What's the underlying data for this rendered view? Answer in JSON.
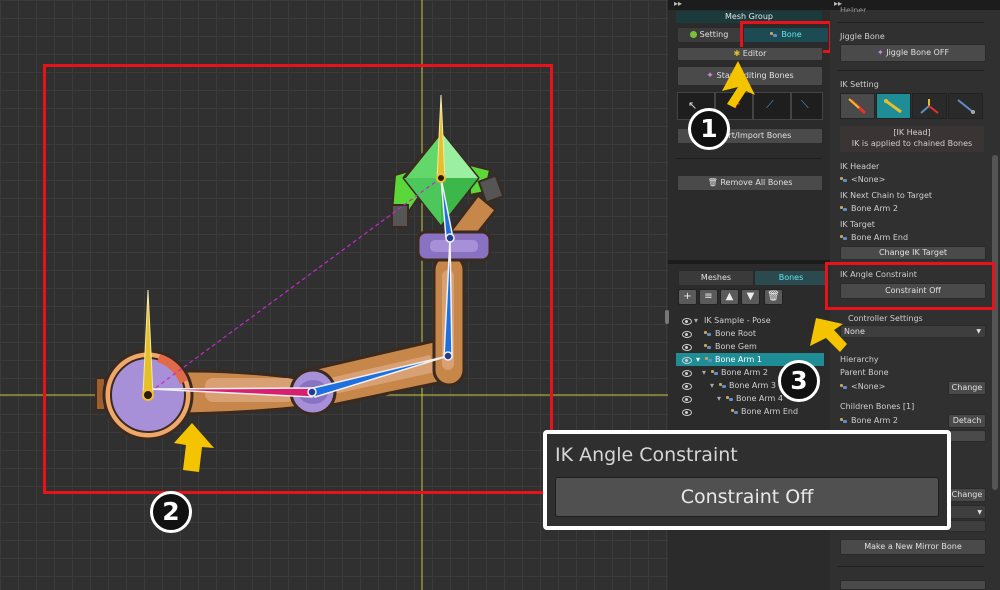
{
  "mesh_group": {
    "title": "Mesh Group",
    "setting_label": "Setting",
    "bone_label": "Bone",
    "editor_label": "Editor",
    "start_editing_label": "Start Editing Bones",
    "export_import_label": "Export/Import Bones",
    "remove_all_label": "Remove All Bones"
  },
  "list_tabs": {
    "meshes": "Meshes",
    "bones": "Bones"
  },
  "tree": [
    {
      "label": "IK Sample - Pose"
    },
    {
      "label": "Bone Root"
    },
    {
      "label": "Bone Gem"
    },
    {
      "label": "Bone Arm 1"
    },
    {
      "label": "Bone Arm 2"
    },
    {
      "label": "Bone Arm 3"
    },
    {
      "label": "Bone Arm 4"
    },
    {
      "label": "Bone Arm End"
    }
  ],
  "inspector": {
    "header_cut": "Helper",
    "jiggle_title": "Jiggle Bone",
    "jiggle_button": "Jiggle Bone OFF",
    "ik_setting": "IK Setting",
    "ik_info_line1": "[IK Head]",
    "ik_info_line2": "IK is applied to chained Bones",
    "ik_header_label": "IK Header",
    "ik_header_value": "<None>",
    "ik_next_label": "IK Next Chain to Target",
    "ik_next_value": "Bone Arm 2",
    "ik_target_label": "IK Target",
    "ik_target_value": "Bone Arm End",
    "change_ik_target": "Change IK Target",
    "ik_angle_label": "IK Angle Constraint",
    "constraint_off": "Constraint Off",
    "controller_settings": "Controller Settings",
    "controller_value": "None",
    "hierarchy": "Hierarchy",
    "parent_bone": "Parent Bone",
    "parent_value": "<None>",
    "change": "Change",
    "children_bones": "Children Bones [1]",
    "child_value": "Bone Arm 2",
    "detach": "Detach",
    "change2": "Change",
    "make_mirror": "Make a New Mirror Bone"
  },
  "zoom_popup": {
    "title": "IK Angle Constraint",
    "button": "Constraint Off"
  },
  "callouts": {
    "c1": "1",
    "c2": "2",
    "c3": "3"
  },
  "colors": {
    "highlight_red": "#e8121a",
    "arrow_yellow": "#f5c400",
    "selected_row": "#1f8d96",
    "bone_blue": "#1e6fe0",
    "axis_yellow": "#c8c83c"
  }
}
